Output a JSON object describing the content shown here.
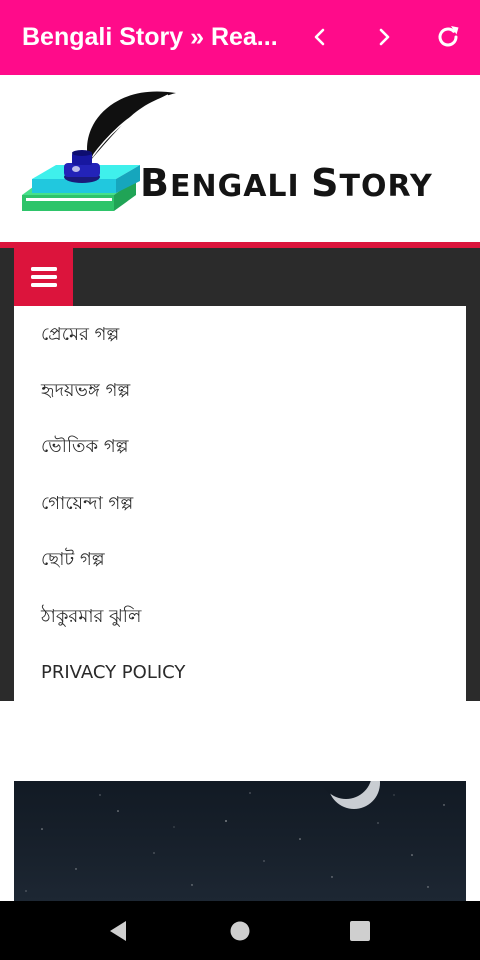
{
  "appbar": {
    "title": "Bengali Story » Rea...",
    "back_icon": "chevron-left-icon",
    "forward_icon": "chevron-right-icon",
    "refresh_icon": "refresh-icon",
    "color": "#ff0b8a"
  },
  "logo": {
    "text_first": "B",
    "text_rest": "ENGALI",
    "text_space": " ",
    "text_second": "S",
    "text_second_rest": "TORY"
  },
  "menu": {
    "toggle_icon": "hamburger-icon",
    "accent": "#dc143c",
    "items": [
      "প্রেমের গল্প",
      "হৃদয়ভঙ্গ গল্প",
      "ভৌতিক গল্প",
      "গোয়েন্দা গল্প",
      "ছোট গল্প",
      "ঠাকুরমার ঝুলি",
      "PRIVACY POLICY"
    ]
  },
  "featured_image": {
    "subject": "night sky with crescent moon"
  },
  "system_nav": {
    "back": "nav-back-icon",
    "home": "nav-home-icon",
    "recents": "nav-recents-icon"
  }
}
